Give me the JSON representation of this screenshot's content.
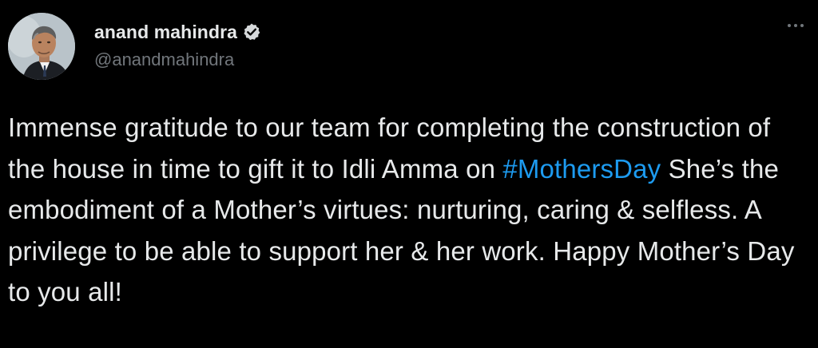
{
  "author": {
    "display_name": "anand mahindra",
    "handle": "@anandmahindra",
    "verified": true,
    "avatar_icon": "profile-photo"
  },
  "tweet": {
    "text_before": "Immense gratitude to our team for completing the construction of the house in time to gift it to Idli Amma on ",
    "hashtag": "#MothersDay",
    "text_after": " She’s the embodiment of a Mother’s virtues: nurturing, caring & selfless. A privilege to be able to support her & her work. Happy Mother’s Day to you all!"
  },
  "icons": {
    "more": "more-options-icon",
    "verified": "verified-badge-icon"
  },
  "colors": {
    "background": "#000000",
    "text": "#e7e9ea",
    "secondary_text": "#71767b",
    "link": "#1d9bf0"
  }
}
